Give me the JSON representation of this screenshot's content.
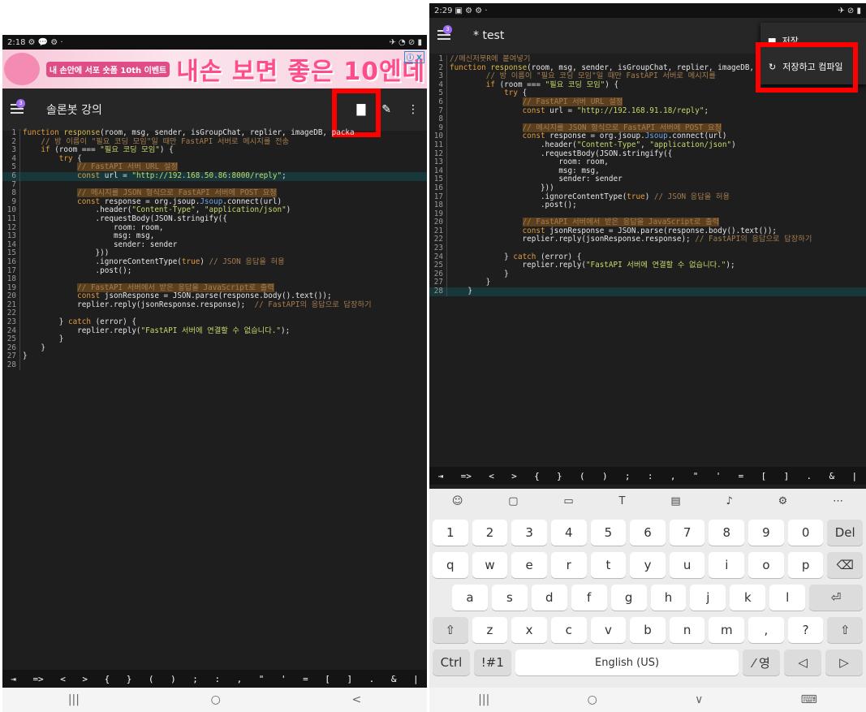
{
  "left": {
    "status": {
      "time": "2:18",
      "icons_l": "⚙ 💬 ⚙ ·",
      "icons_r": "✈ ◔ ⊘ ▮"
    },
    "ad": {
      "tag": "내 손안에 서포 숏폼 10th 이벤트",
      "headline": "내손 보면 좋은 10엔데",
      "close": "ⓘ X"
    },
    "appbar": {
      "badge": "3",
      "title": "솔론봇 강의"
    },
    "keys": [
      "⇥",
      "=>",
      "<",
      ">",
      "{",
      "}",
      "(",
      ")",
      ";",
      ":",
      ",",
      "\"",
      "'",
      "=",
      "[",
      "]",
      ".",
      "&",
      "|"
    ]
  },
  "right": {
    "status": {
      "time": "2:29",
      "icons_l": "▣ ⚙ ⚙ ·",
      "icons_r": "✈ ⊘ ▮"
    },
    "appbar": {
      "badge": "3",
      "title": "* test"
    },
    "menu": {
      "save": "저장",
      "save_compile": "저장하고 컴파일"
    },
    "keys": [
      "⇥",
      "=>",
      "<",
      ">",
      "{",
      "}",
      "(",
      ")",
      ";",
      ":",
      ",",
      "\"",
      "'",
      "=",
      "[",
      "]",
      ".",
      "&",
      "|"
    ],
    "keyboard": {
      "row1": [
        "1",
        "2",
        "3",
        "4",
        "5",
        "6",
        "7",
        "8",
        "9",
        "0",
        "Del"
      ],
      "row2": [
        "q",
        "w",
        "e",
        "r",
        "t",
        "y",
        "u",
        "i",
        "o",
        "p",
        "⌫"
      ],
      "row3": [
        "a",
        "s",
        "d",
        "f",
        "g",
        "h",
        "j",
        "k",
        "l",
        "⏎"
      ],
      "row4": [
        "⇧",
        "z",
        "x",
        "c",
        "v",
        "b",
        "n",
        "m",
        ",",
        "?",
        "⇧"
      ],
      "row5": {
        "ctrl": "Ctrl",
        "sym": "!#1",
        "space": "English (US)",
        "lang": "⁄ 영",
        "left": "◁",
        "right": "▷"
      }
    }
  },
  "nav": {
    "recent": "|||",
    "home": "○",
    "back": "<",
    "down": "∨",
    "kbd": "⌨"
  }
}
